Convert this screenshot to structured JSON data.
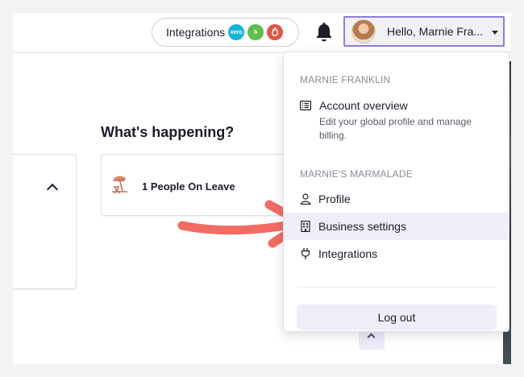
{
  "topbar": {
    "integrations_label": "Integrations",
    "integration_apps": [
      {
        "name": "xero",
        "label": "xero",
        "color": "#1ab4d7"
      },
      {
        "name": "b",
        "label": "b",
        "color": "#5fbf4a"
      },
      {
        "name": "flame",
        "label": "",
        "color": "#e0574a"
      }
    ],
    "user_greeting": "Hello, Marnie Fra..."
  },
  "main": {
    "section_title": "What's happening?",
    "leave_card_text": "1 People On Leave"
  },
  "menu": {
    "user_section_label": "MARNIE FRANKLIN",
    "account_overview_title": "Account overview",
    "account_overview_desc": "Edit your global profile and manage billing.",
    "business_section_label": "MARNIE'S MARMALADE",
    "items": [
      {
        "label": "Profile",
        "icon": "person-icon"
      },
      {
        "label": "Business settings",
        "icon": "building-icon"
      },
      {
        "label": "Integrations",
        "icon": "plug-icon"
      }
    ],
    "logout_label": "Log out"
  },
  "colors": {
    "accent": "#8f7ddc",
    "highlight": "#efedf7",
    "arrow": "#f26c64"
  }
}
